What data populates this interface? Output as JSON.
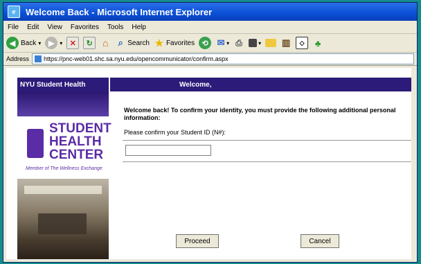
{
  "window": {
    "title": "Welcome Back - Microsoft Internet Explorer"
  },
  "menu": {
    "items": [
      "File",
      "Edit",
      "View",
      "Favorites",
      "Tools",
      "Help"
    ]
  },
  "toolbar": {
    "back_label": "Back",
    "search_label": "Search",
    "favorites_label": "Favorites"
  },
  "address": {
    "label": "Address",
    "url": "https://pnc-web01.shc.sa.nyu.edu/opencommunicator/confirm.aspx"
  },
  "sidebar": {
    "header": "NYU Student Health",
    "logo": {
      "line1": "STUDENT",
      "line2": "HEALTH",
      "line3": "CENTER",
      "tagline": "Member of The Wellness Exchange"
    }
  },
  "main": {
    "header": "Welcome,",
    "message": "Welcome back! To confirm your identity, you must provide the following additional personal information:",
    "field_label": "Please confirm your Student ID (N#):",
    "student_id_value": "",
    "proceed_label": "Proceed",
    "cancel_label": "Cancel"
  }
}
